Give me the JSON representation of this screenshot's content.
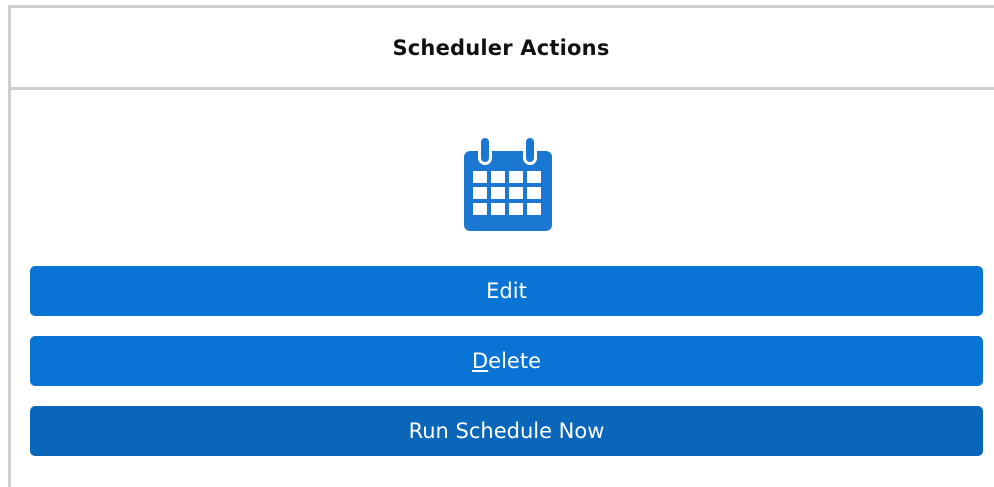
{
  "dialog": {
    "title": "Scheduler Actions",
    "icon": "calendar-icon"
  },
  "buttons": {
    "edit_label": "Edit",
    "delete_mnemonic": "D",
    "delete_rest": "elete",
    "run_label": "Run Schedule Now"
  },
  "colors": {
    "button_blue": "#0a74d6",
    "button_blue_focused": "#0966b9",
    "icon_blue": "#1a78d2",
    "border_gray": "#cfcfcf"
  }
}
